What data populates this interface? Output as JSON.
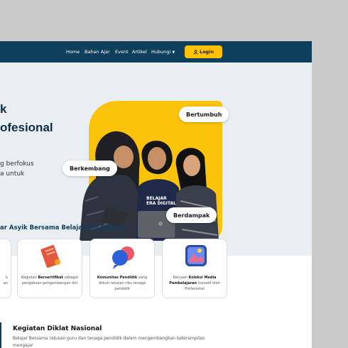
{
  "nav": {
    "links": [
      "Home",
      "Bahan Ajar",
      "Event",
      "Artikel",
      "Hubungi"
    ],
    "login_label": "Login",
    "bg_color": "#0e3f5c",
    "accent_color": "#ffc107"
  },
  "hero": {
    "title_line1": "k",
    "title_line2": "ofesional",
    "sub_line1": "g berfokus",
    "sub_line2": "a untuk",
    "tags": [
      "Bertumbuh",
      "Berkembang",
      "Berdampak"
    ],
    "shirt_text_line1": "BELAJAR",
    "shirt_text_line2": "ERA DIGITAL"
  },
  "features": {
    "section_title": "ar Asyik Bersama Belajar Era Digital",
    "cards": [
      {
        "line1": "k",
        "line2": "an",
        "icon": "partial-icon"
      },
      {
        "pre": "Kegiatan ",
        "bold": "Bersertifikat",
        "rest": " sebagai pengakuan pengembangan diri",
        "icon": "certificate-icon"
      },
      {
        "pre": "",
        "bold": "Komunitas Pendidik",
        "rest": " yang diikuti ratusan ribu tenaga pendidik",
        "icon": "chat-bubbles-icon"
      },
      {
        "pre": "Ratusan ",
        "bold": "Koleksi Media Pembelajaran",
        "rest": " inovatif oleh Profesional",
        "icon": "media-collection-icon"
      }
    ]
  },
  "diklat": {
    "title": "Kegiatan Diklat Nasional",
    "text": "Belajar Bersama ratusan guru dan tenaga pendidik dalam mengembangkan keterampilan mengajar"
  }
}
